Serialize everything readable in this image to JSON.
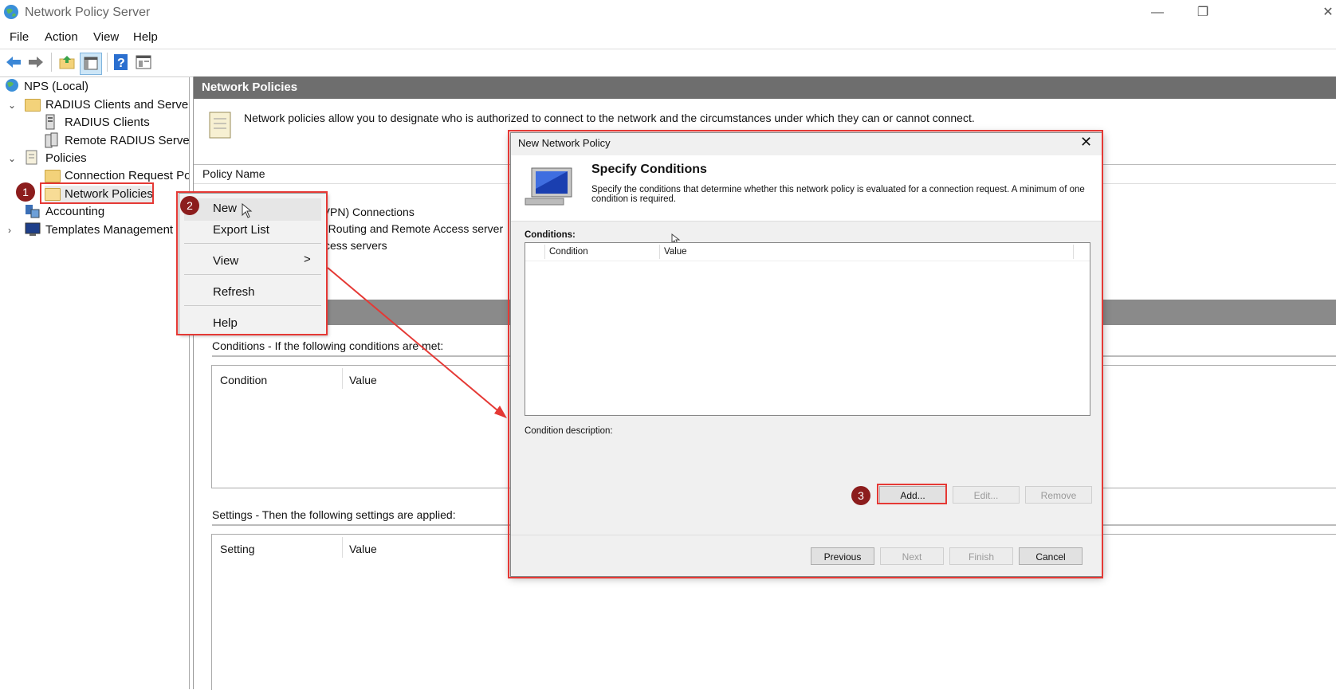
{
  "window": {
    "title": "Network Policy Server",
    "controls": {
      "minimize": "—",
      "restore": "❐",
      "close": "✕"
    }
  },
  "menubar": {
    "items": [
      "File",
      "Action",
      "View",
      "Help"
    ]
  },
  "toolbar": {
    "icons": [
      "back-arrow-icon",
      "forward-arrow-icon",
      "up-folder-icon",
      "show-hide-console-tree-icon",
      "help-icon",
      "properties-icon"
    ]
  },
  "tree": {
    "root": "NPS (Local)",
    "radius_group": "RADIUS Clients and Servers",
    "radius_clients": "RADIUS Clients",
    "remote_radius": "Remote RADIUS Server (",
    "policies": "Policies",
    "connection_request": "Connection Request Pol",
    "network_policies": "Network Policies",
    "accounting": "Accounting",
    "templates": "Templates Management"
  },
  "main": {
    "header": "Network Policies",
    "description": "Network policies allow you to designate who is authorized to connect to the network and the circumstances under which they can or cannot connect.",
    "list_header": "Policy Name",
    "rows": [
      "(VPN) Connections",
      "ft Routing and Remote Access server",
      "ccess servers"
    ],
    "conditions_label": "Conditions - If the following conditions are met:",
    "conditions_cols": [
      "Condition",
      "Value"
    ],
    "settings_label": "Settings - Then the following settings are applied:",
    "settings_cols": [
      "Setting",
      "Value"
    ]
  },
  "context_menu": {
    "items": [
      "New",
      "Export List",
      "View",
      "Refresh",
      "Help"
    ],
    "submenu_arrow": ">"
  },
  "dialog": {
    "title": "New Network Policy",
    "heading": "Specify Conditions",
    "description": "Specify the conditions that determine whether this network policy is evaluated for a connection request. A minimum of one condition is required.",
    "conditions_label": "Conditions:",
    "table_cols": [
      "Condition",
      "Value"
    ],
    "condition_description_label": "Condition description:",
    "buttons": {
      "add": "Add...",
      "edit": "Edit...",
      "remove": "Remove"
    },
    "nav": {
      "previous": "Previous",
      "next": "Next",
      "finish": "Finish",
      "cancel": "Cancel"
    }
  },
  "callouts": [
    "1",
    "2",
    "3"
  ],
  "colors": {
    "highlight_red": "#e53935",
    "callout_bg": "#8c1d1d",
    "header_gray": "#6e6e6e"
  }
}
